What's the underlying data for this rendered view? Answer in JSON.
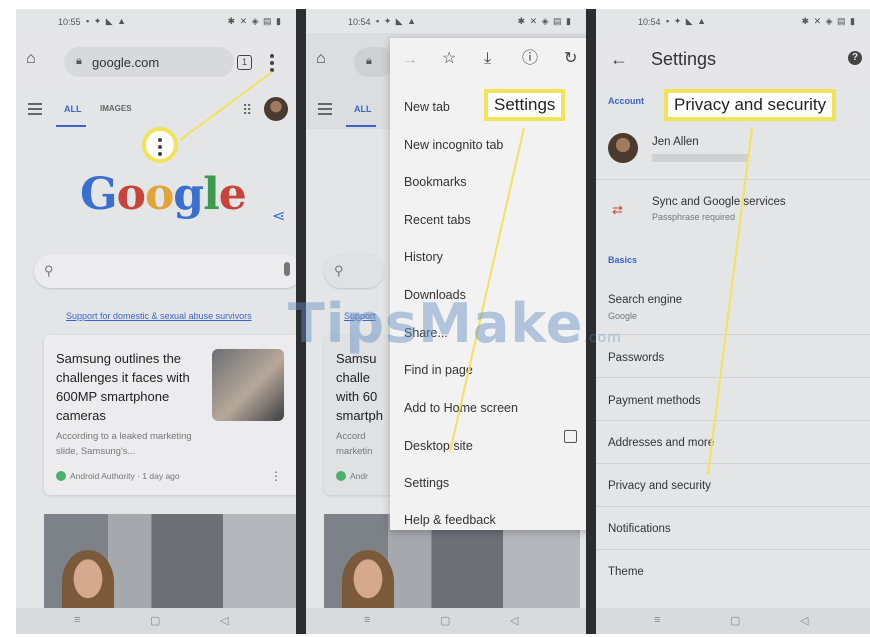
{
  "status": {
    "time_left": "10:55",
    "time_middle": "10:54",
    "time_right": "10:54"
  },
  "browser": {
    "url": "google.com",
    "tab_count": "1",
    "tabs": {
      "all": "ALL",
      "images": "IMAGES"
    },
    "logo_letters": [
      "G",
      "o",
      "o",
      "g",
      "l",
      "e"
    ],
    "support_link": "Support for domestic & sexual abuse survivors",
    "support_link_partial": "Support",
    "news_card": {
      "headline": "Samsung outlines the challenges it faces with 600MP smartphone cameras",
      "snippet": "According to a leaked marketing slide, Samsung's...",
      "source": "Android Authority · 1 day ago",
      "headline_partial": [
        "Samsu",
        "challe",
        "with 60",
        "smartph"
      ],
      "snippet_partial": [
        "Accord",
        "marketin"
      ],
      "source_partial": "Andr"
    }
  },
  "menu": {
    "items": [
      "New tab",
      "New incognito tab",
      "Bookmarks",
      "Recent tabs",
      "History",
      "Downloads",
      "Share...",
      "Find in page",
      "Add to Home screen",
      "Desktop site",
      "Settings",
      "Help & feedback"
    ]
  },
  "settings": {
    "title": "Settings",
    "account_label": "Account",
    "user_name": "Jen Allen",
    "sync_title": "Sync and Google services",
    "sync_sub": "Passphrase required",
    "basics_label": "Basics",
    "search_engine": "Search engine",
    "search_engine_value": "Google",
    "rows": [
      "Passwords",
      "Payment methods",
      "Addresses and more",
      "Privacy and security",
      "Notifications",
      "Theme"
    ]
  },
  "callouts": {
    "settings": "Settings",
    "privacy": "Privacy and security"
  },
  "watermark": {
    "text": "TipsMake",
    "suffix": ".com"
  },
  "colors": {
    "callout_border": "#f1e35a",
    "accent_blue": "#3a66c9",
    "panel_bg": "#e4e5e7"
  }
}
